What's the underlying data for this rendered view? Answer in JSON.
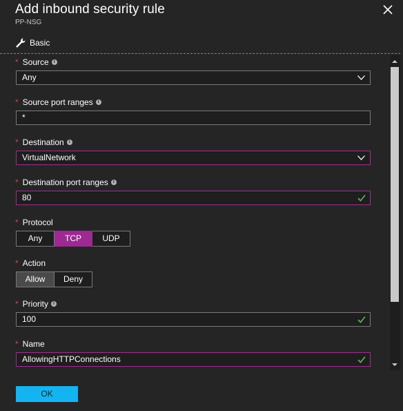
{
  "blade": {
    "title": "Add inbound security rule",
    "subtitle": "PP-NSG",
    "close_icon": "close-icon"
  },
  "tab": {
    "icon": "wrench-icon",
    "label": "Basic"
  },
  "fields": {
    "source": {
      "required": "*",
      "label": "Source",
      "value": "Any",
      "has_info": true
    },
    "source_port_ranges": {
      "required": "*",
      "label": "Source port ranges",
      "value": "*",
      "has_info": true
    },
    "destination": {
      "required": "*",
      "label": "Destination",
      "value": "VirtualNetwork",
      "has_info": true
    },
    "destination_port_ranges": {
      "required": "*",
      "label": "Destination port ranges",
      "value": "80",
      "has_info": true,
      "valid": true
    },
    "protocol": {
      "required": "*",
      "label": "Protocol",
      "options": [
        "Any",
        "TCP",
        "UDP"
      ],
      "selected": "TCP"
    },
    "action": {
      "required": "*",
      "label": "Action",
      "options": [
        "Allow",
        "Deny"
      ],
      "selected": "Allow"
    },
    "priority": {
      "required": "*",
      "label": "Priority",
      "value": "100",
      "has_info": true,
      "valid": true
    },
    "name": {
      "required": "*",
      "label": "Name",
      "value": "AllowingHTTPConnections",
      "valid": true
    }
  },
  "footer": {
    "ok_label": "OK"
  },
  "colors": {
    "background": "#252526",
    "accent_purple": "#9c2a92",
    "focus_border": "#a12e8f",
    "ok_button": "#14b4f0",
    "required_star": "#e0403c",
    "valid_check": "#5cb85c"
  }
}
